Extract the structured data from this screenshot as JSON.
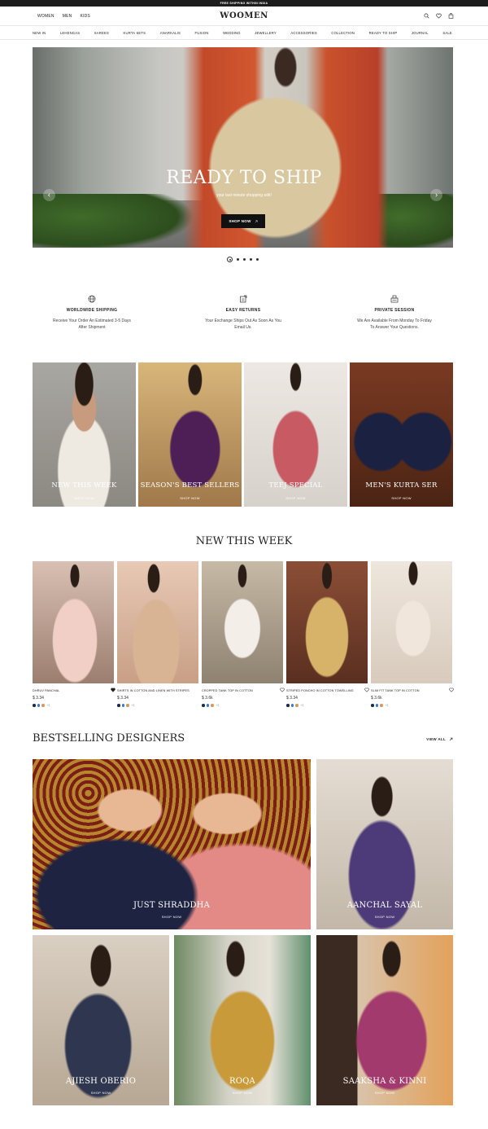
{
  "topbar": {
    "text": "FREE SHIPPING WITHIN INDIA"
  },
  "header": {
    "nav": [
      "WOMEN",
      "MEN",
      "KIDS"
    ],
    "logo": "WOOMEN",
    "icons": [
      "search-icon",
      "heart-icon",
      "bag-icon"
    ]
  },
  "menu": [
    "NEW IN",
    "LEHENGAS",
    "SAREES",
    "KURTA SETS",
    "ANARKALIS",
    "FUSION",
    "WEDDING",
    "JEWELLERY",
    "ACCESSORIES",
    "COLLECTION",
    "READY TO SHIP",
    "JOURNAL",
    "SALE"
  ],
  "hero": {
    "title": "READY TO SHIP",
    "subtitle": "your last minute shopping edit!",
    "button": "SHOP NOW",
    "slide_count": 5,
    "active_slide": 1
  },
  "features": [
    {
      "icon": "globe-icon",
      "title": "WORLDWIDE SHIPPING",
      "line1": "Receive Your Order An Estimated 3-5 Days",
      "line2": "After Shipment"
    },
    {
      "icon": "return-icon",
      "title": "EASY RETURNS",
      "line1": "Your Exchange Ships Out As Soon As You",
      "line2": "Email Us."
    },
    {
      "icon": "session-icon",
      "title": "PRIVATE SESSION",
      "line1": "We Are Available From Monday To Friday",
      "line2": "To Answer Your Questions."
    }
  ],
  "categories": [
    {
      "label": "NEW THIS WEEK",
      "cta": "SHOP NOW"
    },
    {
      "label": "SEASON'S BEST SELLERS",
      "cta": "SHOP NOW"
    },
    {
      "label": "TEEJ SPECIAL",
      "cta": "SHOP NOW"
    },
    {
      "label": "MEN'S KURTA SER",
      "cta": "SHOP NOW"
    }
  ],
  "new_week": {
    "title": "NEW THIS WEEK",
    "products": [
      {
        "name": "DHRUV PANCHAL",
        "price": "$ 3.34",
        "more": "+2",
        "colors": [
          "#1f2a44",
          "#3a7bd5",
          "#d29a5b"
        ]
      },
      {
        "name": "SHIRTS IN COTTON AND LINEN WITH STRIPES",
        "price": "$ 3.34",
        "more": "+2",
        "colors": [
          "#1f2a44",
          "#3a7bd5",
          "#d29a5b"
        ]
      },
      {
        "name": "CROPPED TANK TOP IN COTTON",
        "price": "$ 3.6k",
        "more": "+2",
        "colors": [
          "#1f2a44",
          "#3a7bd5",
          "#d29a5b"
        ]
      },
      {
        "name": "STRIPED PONCHO IN COTTON TOWELLING",
        "price": "$ 3.34",
        "more": "+2",
        "colors": [
          "#1f2a44",
          "#3a7bd5",
          "#d29a5b"
        ]
      },
      {
        "name": "SLIM FIT TANK TOP IN COTTON",
        "price": "$ 3.6k",
        "more": "+2",
        "colors": [
          "#1f2a44",
          "#3a7bd5",
          "#d29a5b"
        ]
      }
    ]
  },
  "bestselling": {
    "title": "BESTSELLING DESIGNERS",
    "view_all": "VIEW ALL",
    "designers": [
      {
        "label": "JUST SHRADDHA",
        "cta": "SHOP NOW"
      },
      {
        "label": "AANCHAL SAYAL",
        "cta": "SHOP NOW"
      },
      {
        "label": "AJIESH OBERIO",
        "cta": "SHOP NOW"
      },
      {
        "label": "ROQA",
        "cta": "SHOP NOW"
      },
      {
        "label": "SAAKSHA & KINNI",
        "cta": "SHOP NOW"
      }
    ]
  }
}
